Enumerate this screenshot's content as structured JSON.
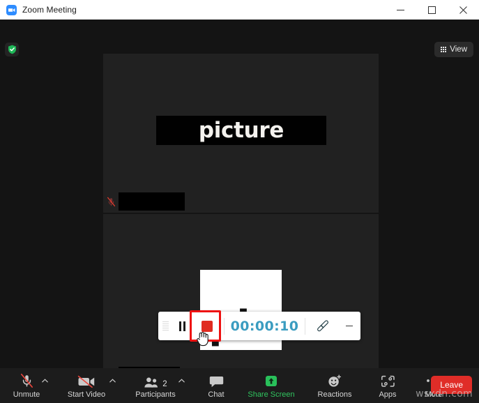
{
  "window": {
    "title": "Zoom Meeting",
    "logo_icon": "zoom-camera-icon",
    "controls": {
      "minimize": "minimize-icon",
      "maximize": "maximize-icon",
      "close": "close-icon"
    }
  },
  "meeting": {
    "encryption_icon": "green-shield-check-icon",
    "view_button": {
      "label": "View",
      "icon": "grid-view-icon"
    },
    "tiles": [
      {
        "id": "top",
        "overlay_text": "picture",
        "name_redacted": true,
        "mic_icon": "mic-muted-icon"
      },
      {
        "id": "bottom",
        "shared_text": "pic",
        "name_redacted": true,
        "mic_icon": "mic-muted-icon"
      }
    ]
  },
  "recording_bar": {
    "drag_handle_icon": "drag-handle-icon",
    "pause_icon": "pause-icon",
    "stop_icon": "stop-record-icon",
    "timer": "00:00:10",
    "annotate_icon": "paintbrush-icon",
    "minimize_icon": "minimize-icon",
    "highlight_color": "#ee1111",
    "timer_color": "#3a9cc0",
    "stop_color": "#e02b20"
  },
  "toolbar": {
    "items": [
      {
        "label": "Unmute",
        "icon": "mic-muted-icon",
        "caret": true,
        "green": false
      },
      {
        "label": "Start Video",
        "icon": "video-off-icon",
        "caret": true,
        "green": false
      },
      {
        "label": "Participants",
        "icon": "participants-icon",
        "caret": true,
        "green": false,
        "count": "2"
      },
      {
        "label": "Chat",
        "icon": "chat-bubble-icon",
        "caret": false,
        "green": false
      },
      {
        "label": "Share Screen",
        "icon": "share-screen-icon",
        "caret": false,
        "green": true
      },
      {
        "label": "Reactions",
        "icon": "reactions-icon",
        "caret": false,
        "green": false
      },
      {
        "label": "Apps",
        "icon": "apps-icon",
        "caret": false,
        "green": false
      },
      {
        "label": "More",
        "icon": "more-dots-icon",
        "caret": false,
        "green": false
      }
    ],
    "leave_label": "Leave",
    "leave_color": "#e02d28"
  },
  "watermark": {
    "text": "wsxdn.com"
  }
}
